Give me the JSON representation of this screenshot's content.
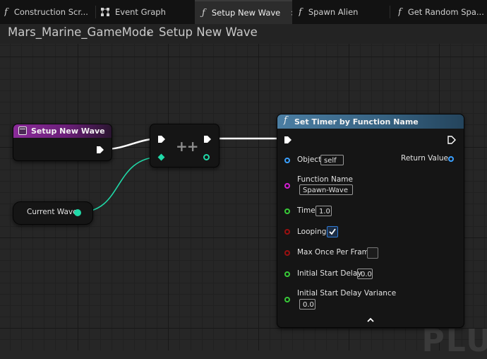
{
  "tabs": [
    {
      "label": "Construction Scr...",
      "icon": "function-icon"
    },
    {
      "label": "Event Graph",
      "icon": "event-graph-icon"
    },
    {
      "label": "Setup New Wave",
      "icon": "function-icon",
      "active": true,
      "close": "×"
    },
    {
      "label": "Spawn Alien",
      "icon": "function-icon"
    },
    {
      "label": "Get Random Spa...",
      "icon": "function-icon"
    }
  ],
  "breadcrumb": {
    "parent": "Mars_Marine_GameMode",
    "separator": "›",
    "current": "Setup New Wave"
  },
  "nodes": {
    "entry": {
      "title": "Setup New Wave",
      "color": "#8b2b9a"
    },
    "increment": {
      "symbol": "++"
    },
    "variable": {
      "label": "Current Wave"
    },
    "timer": {
      "title": "Set Timer by Function Name",
      "icon_glyph": "f",
      "header_color": "#3f6d8f",
      "object_label": "Object",
      "object_value": "self",
      "return_label": "Return Value",
      "function_name_label": "Function Name",
      "function_name_value": "Spawn-Wave",
      "time_label": "Time",
      "time_value": "1.0",
      "looping_label": "Looping",
      "looping_checked": true,
      "max_once_label": "Max Once Per Frame",
      "max_once_checked": false,
      "initial_delay_label": "Initial Start Delay",
      "initial_delay_value": "0.0",
      "variance_label": "Initial Start Delay Variance",
      "variance_value": "0.0",
      "collapse_glyph": "⌃"
    }
  },
  "watermark": "PLU",
  "colors": {
    "object_pin": "#3aa0ff",
    "string_pin": "#d21fd2",
    "float_pin": "#38c938",
    "bool_pin": "#9a1010",
    "int_pin": "#20d9a8",
    "exec_wire": "#ffffff"
  }
}
